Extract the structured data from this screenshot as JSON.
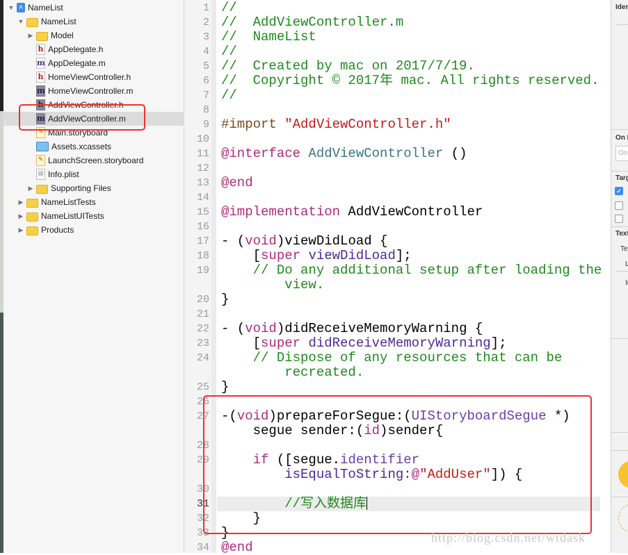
{
  "navigator": {
    "items": [
      {
        "label": "NameList",
        "level": 0,
        "icon": "project-icon",
        "disclosure": "open"
      },
      {
        "label": "NameList",
        "level": 1,
        "icon": "folder-icon",
        "disclosure": "open"
      },
      {
        "label": "Model",
        "level": 2,
        "icon": "folder-icon",
        "disclosure": "closed"
      },
      {
        "label": "AppDelegate.h",
        "level": 2,
        "icon": "header-file-icon"
      },
      {
        "label": "AppDelegate.m",
        "level": 2,
        "icon": "impl-file-icon"
      },
      {
        "label": "HomeViewController.h",
        "level": 2,
        "icon": "header-file-icon"
      },
      {
        "label": "HomeViewController.m",
        "level": 2,
        "icon": "impl-file-dark-icon"
      },
      {
        "label": "AddViewController.h",
        "level": 2,
        "icon": "header-file-dark-icon"
      },
      {
        "label": "AddViewController.m",
        "level": 2,
        "icon": "impl-file-dark-icon",
        "selected": true
      },
      {
        "label": "Main.storyboard",
        "level": 2,
        "icon": "storyboard-icon"
      },
      {
        "label": "Assets.xcassets",
        "level": 2,
        "icon": "assets-icon"
      },
      {
        "label": "LaunchScreen.storyboard",
        "level": 2,
        "icon": "storyboard-icon"
      },
      {
        "label": "Info.plist",
        "level": 2,
        "icon": "plist-icon"
      },
      {
        "label": "Supporting Files",
        "level": 2,
        "icon": "folder-icon",
        "disclosure": "closed"
      },
      {
        "label": "NameListTests",
        "level": 1,
        "icon": "folder-icon",
        "disclosure": "closed"
      },
      {
        "label": "NameListUITests",
        "level": 1,
        "icon": "folder-icon",
        "disclosure": "closed"
      },
      {
        "label": "Products",
        "level": 1,
        "icon": "folder-icon",
        "disclosure": "closed"
      }
    ]
  },
  "editor": {
    "current_line": 31,
    "lines": [
      {
        "n": "1",
        "t": [
          [
            "comment",
            "//"
          ]
        ]
      },
      {
        "n": "2",
        "t": [
          [
            "comment",
            "//  AddViewController.m"
          ]
        ]
      },
      {
        "n": "3",
        "t": [
          [
            "comment",
            "//  NameList"
          ]
        ]
      },
      {
        "n": "4",
        "t": [
          [
            "comment",
            "//"
          ]
        ]
      },
      {
        "n": "5",
        "t": [
          [
            "comment",
            "//  Created by mac on 2017/7/19."
          ]
        ]
      },
      {
        "n": "6",
        "t": [
          [
            "comment",
            "//  Copyright © 2017年 mac. All rights reserved."
          ]
        ]
      },
      {
        "n": "7",
        "t": [
          [
            "comment",
            "//"
          ]
        ]
      },
      {
        "n": "8",
        "t": []
      },
      {
        "n": "9",
        "t": [
          [
            "pre",
            "#import "
          ],
          [
            "str",
            "\"AddViewController.h\""
          ]
        ]
      },
      {
        "n": "10",
        "t": []
      },
      {
        "n": "11",
        "t": [
          [
            "kw",
            "@interface "
          ],
          [
            "cls",
            "AddViewController"
          ],
          [
            "plain",
            " ()"
          ]
        ]
      },
      {
        "n": "12",
        "t": []
      },
      {
        "n": "13",
        "t": [
          [
            "kw",
            "@end"
          ]
        ]
      },
      {
        "n": "14",
        "t": []
      },
      {
        "n": "15",
        "t": [
          [
            "kw",
            "@implementation"
          ],
          [
            "plain",
            " AddViewController"
          ]
        ]
      },
      {
        "n": "16",
        "t": []
      },
      {
        "n": "17",
        "t": [
          [
            "plain",
            "- ("
          ],
          [
            "kw",
            "void"
          ],
          [
            "plain",
            ")viewDidLoad {"
          ]
        ]
      },
      {
        "n": "18",
        "t": [
          [
            "plain",
            "    ["
          ],
          [
            "kw",
            "super"
          ],
          [
            "plain",
            " "
          ],
          [
            "method",
            "viewDidLoad"
          ],
          [
            "plain",
            "];"
          ]
        ]
      },
      {
        "n": "19",
        "t": [
          [
            "comment",
            "    // Do any additional setup after loading the"
          ]
        ]
      },
      {
        "n": "",
        "t": [
          [
            "comment",
            "        view."
          ]
        ]
      },
      {
        "n": "20",
        "t": [
          [
            "plain",
            "}"
          ]
        ]
      },
      {
        "n": "21",
        "t": []
      },
      {
        "n": "22",
        "t": [
          [
            "plain",
            "- ("
          ],
          [
            "kw",
            "void"
          ],
          [
            "plain",
            ")didReceiveMemoryWarning {"
          ]
        ]
      },
      {
        "n": "23",
        "t": [
          [
            "plain",
            "    ["
          ],
          [
            "kw",
            "super"
          ],
          [
            "plain",
            " "
          ],
          [
            "method",
            "didReceiveMemoryWarning"
          ],
          [
            "plain",
            "];"
          ]
        ]
      },
      {
        "n": "24",
        "t": [
          [
            "comment",
            "    // Dispose of any resources that can be"
          ]
        ]
      },
      {
        "n": "",
        "t": [
          [
            "comment",
            "        recreated."
          ]
        ]
      },
      {
        "n": "25",
        "t": [
          [
            "plain",
            "}"
          ]
        ]
      },
      {
        "n": "26",
        "t": []
      },
      {
        "n": "27",
        "t": [
          [
            "plain",
            "-("
          ],
          [
            "kw",
            "void"
          ],
          [
            "plain",
            ")prepareForSegue:("
          ],
          [
            "type",
            "UIStoryboardSegue"
          ],
          [
            "plain",
            " *)"
          ]
        ]
      },
      {
        "n": "",
        "t": [
          [
            "plain",
            "    segue sender:("
          ],
          [
            "kw",
            "id"
          ],
          [
            "plain",
            ")sender{"
          ]
        ]
      },
      {
        "n": "28",
        "t": []
      },
      {
        "n": "29",
        "t": [
          [
            "plain",
            "    "
          ],
          [
            "kw",
            "if"
          ],
          [
            "plain",
            " ([segue."
          ],
          [
            "type",
            "identifier"
          ]
        ]
      },
      {
        "n": "",
        "t": [
          [
            "plain",
            "        "
          ],
          [
            "method",
            "isEqualToString:"
          ],
          [
            "kw",
            "@"
          ],
          [
            "str",
            "\"AddUser\""
          ],
          [
            "plain",
            "]) {"
          ]
        ]
      },
      {
        "n": "30",
        "t": []
      },
      {
        "n": "31",
        "t": [
          [
            "comment",
            "        //写入数据库"
          ]
        ],
        "caret": true
      },
      {
        "n": "32",
        "t": [
          [
            "plain",
            "    }"
          ]
        ]
      },
      {
        "n": "33",
        "t": [
          [
            "plain",
            "}"
          ]
        ]
      },
      {
        "n": "34",
        "t": [
          [
            "kw",
            "@end"
          ]
        ]
      }
    ]
  },
  "inspector": {
    "identity_header": "Identity",
    "on_demand_header": "On Demand",
    "on_demand_placeholder": "On",
    "target_header": "Target Membership",
    "targets": [
      {
        "checked": true
      },
      {
        "checked": false
      },
      {
        "checked": false
      }
    ],
    "text_header": "Text Settings",
    "text_encoding": "Te",
    "line_endings": "L",
    "indent": "In"
  },
  "watermark": "http://blog.csdn.net/wtdask",
  "colors": {
    "highlight": "#f0302a",
    "selection": "#dcdcdc",
    "comment": "#1f8a1f",
    "keyword": "#b02a7a",
    "string": "#c41a16"
  }
}
